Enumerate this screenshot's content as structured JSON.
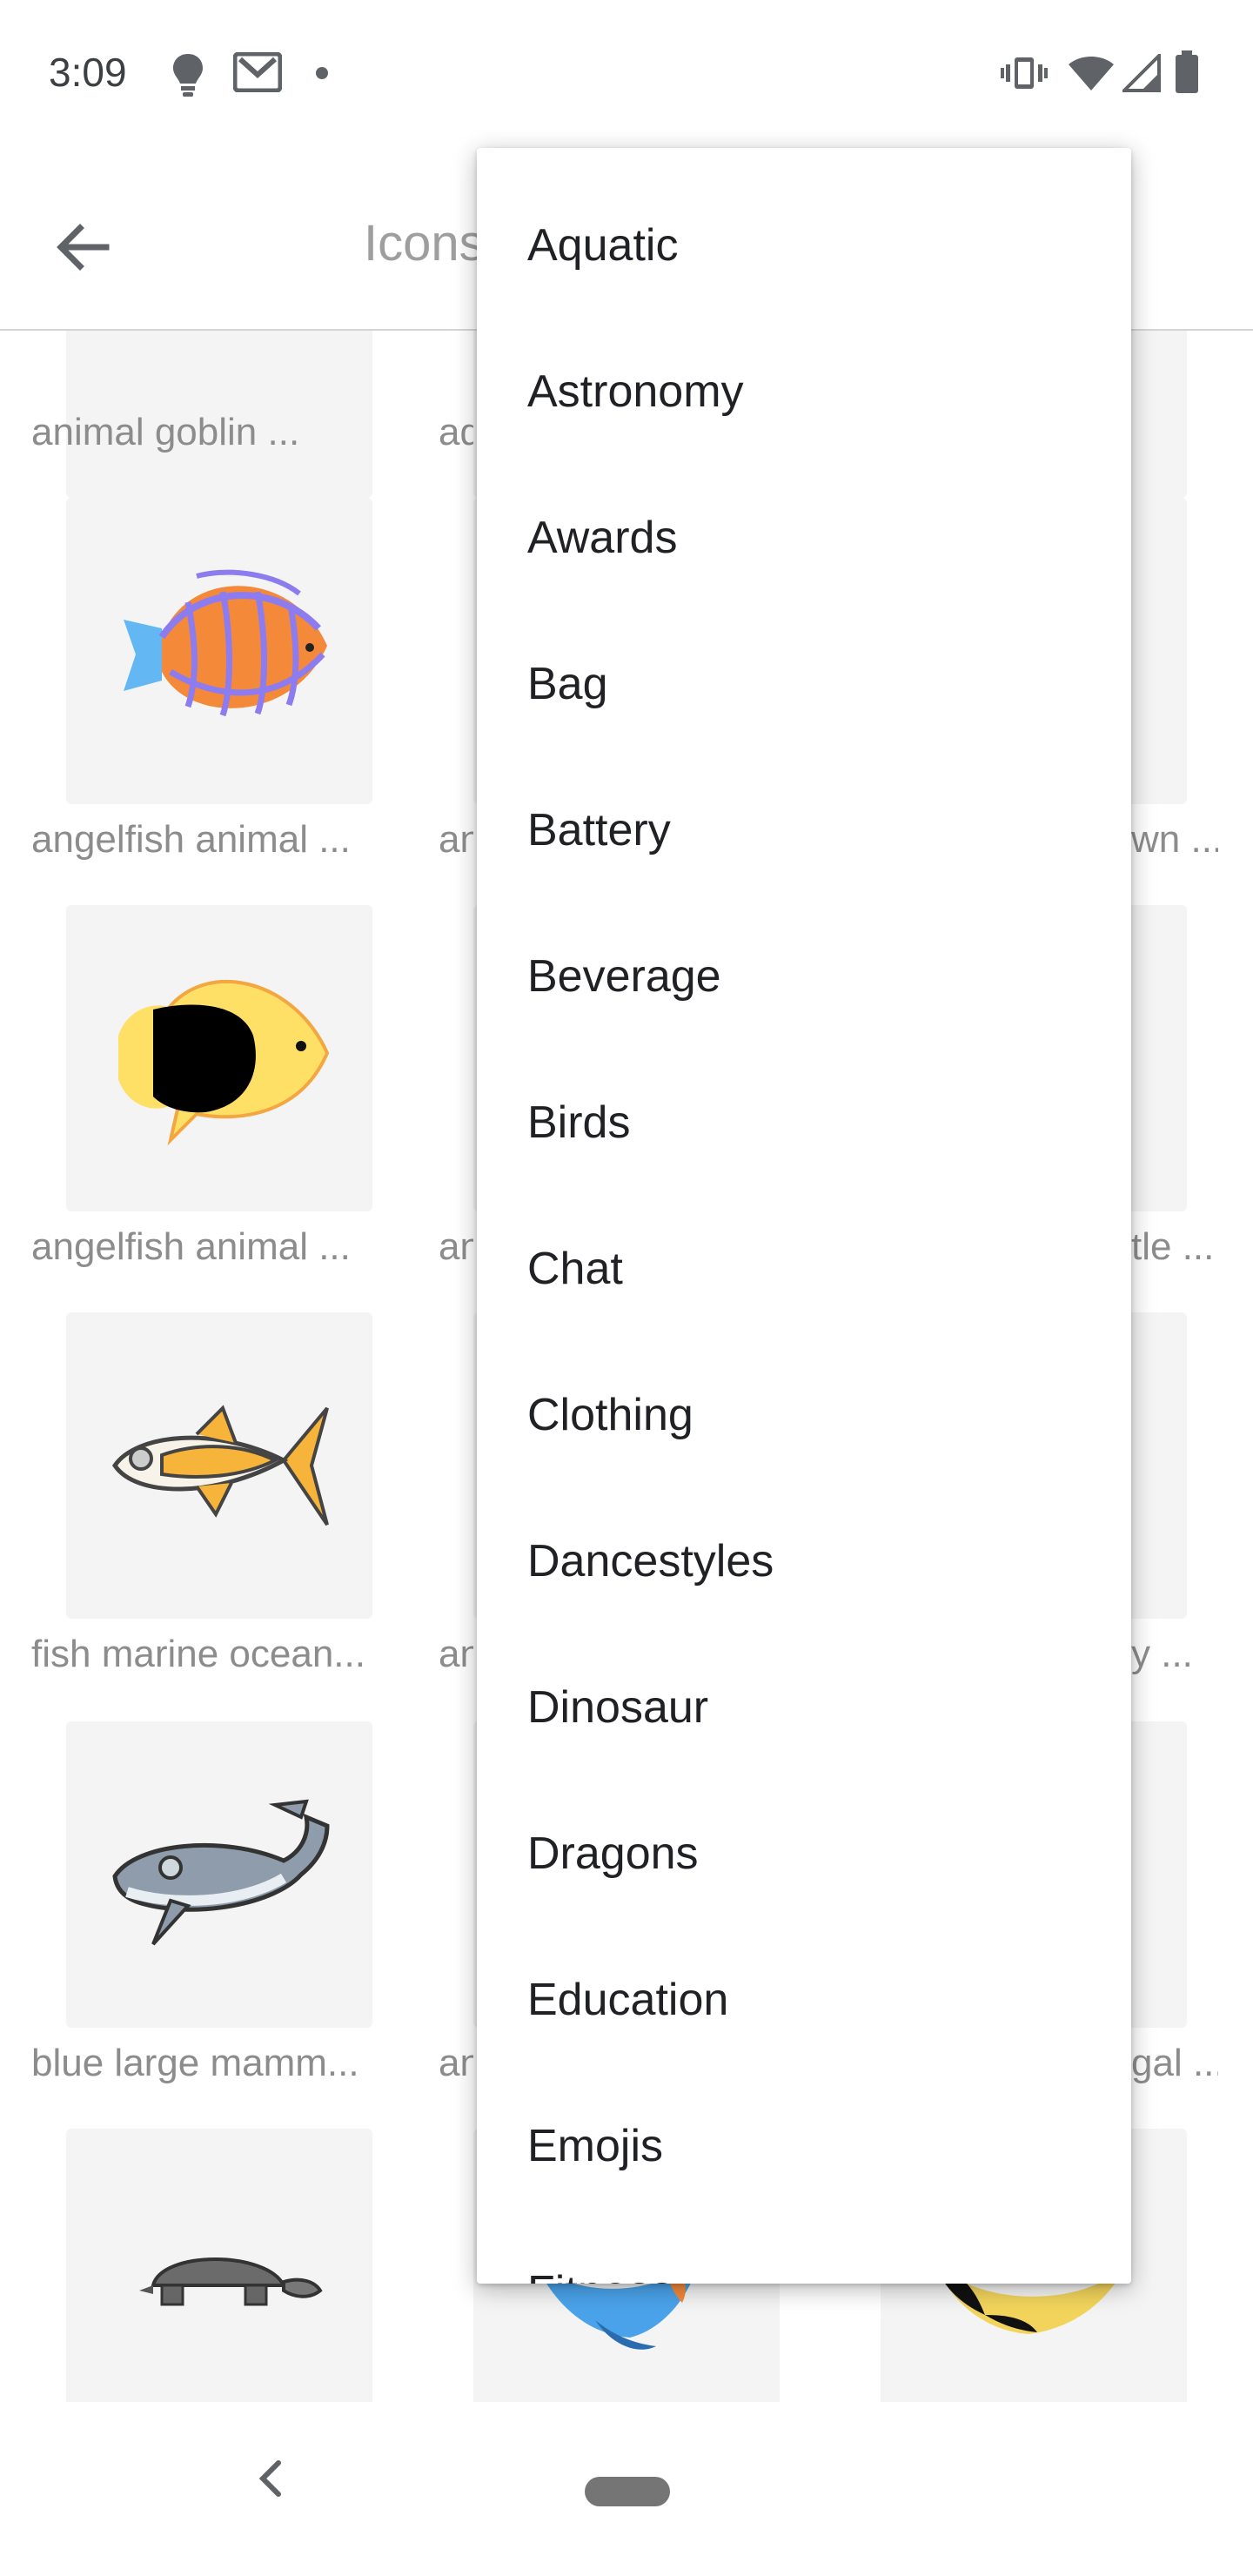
{
  "status_bar": {
    "time": "3:09",
    "icons": [
      "bulb-icon",
      "gmail-icon",
      "dot-icon",
      "vibrate-icon",
      "wifi-icon",
      "signal-icon",
      "battery-icon"
    ]
  },
  "app_bar": {
    "title": "Icons",
    "back_icon": "arrow-left-icon"
  },
  "grid": {
    "captions": {
      "r0c0": "animal goblin ...",
      "r0c1": "ad",
      "r1c0": "angelfish animal ...",
      "r1c1": "an",
      "r1c2": "wn ...",
      "r2c0": "angelfish animal ...",
      "r2c1": "an",
      "r2c2": "tle ...",
      "r3c0": "fish marine ocean...",
      "r3c1": "an",
      "r3c2": "y ...",
      "r4c0": "blue large mamm...",
      "r4c1": "an",
      "r4c2": "gal ..."
    }
  },
  "dropdown": {
    "items": [
      "Aquatic",
      "Astronomy",
      "Awards",
      "Bag",
      "Battery",
      "Beverage",
      "Birds",
      "Chat",
      "Clothing",
      "Dancestyles",
      "Dinosaur",
      "Dragons",
      "Education",
      "Emojis",
      "Fitness"
    ]
  },
  "nav_bar": {
    "back_icon": "chevron-left-icon",
    "home_icon": "home-pill-icon"
  }
}
